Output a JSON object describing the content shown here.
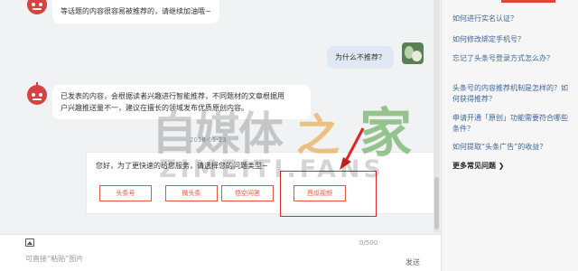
{
  "chat": {
    "messages": [
      {
        "from": "bot",
        "text": "等话题的内容很容易被推荐的，请继续加油哦~"
      },
      {
        "from": "user",
        "text": "为什么不推荐？"
      },
      {
        "from": "bot",
        "lines": [
          "已发表的内容，会根据读者兴趣进行智能推荐，不同题材的文章根据用",
          "户兴趣推送量不一，建议在擅长的领域发布优质原创内容。"
        ]
      }
    ],
    "timestamp": "2018-01-23",
    "card": {
      "prompt": "您好，为了更快速的给您服务，请选择您的问题类型~",
      "options": [
        "头条号",
        "微头条",
        "悟空问答",
        "西瓜视频"
      ]
    }
  },
  "input": {
    "placeholder": "可直接“粘贴”图片",
    "char_count": "0/500",
    "send_label": "发送"
  },
  "sidebar": {
    "faqs": [
      "如何进行实名认证？",
      "如何修改绑定手机号？",
      "忘记了头条号登录方式怎么办？",
      "头条号的内容推荐机制是怎样的？如何获得推荐？",
      "申请开通「原创」功能需要符合哪些条件？",
      "如何提取“头条广告”的收益？"
    ],
    "more_label": "更多常见问题 ❯"
  },
  "watermark": {
    "zh": "自媒体",
    "zhi": "之",
    "jia": "家",
    "en": "ZIMEITI.FANS"
  },
  "colors": {
    "accent_red": "#e6543d",
    "highlight_red": "#e02424",
    "link_blue": "#406599",
    "user_bubble": "#dfe8f3"
  }
}
